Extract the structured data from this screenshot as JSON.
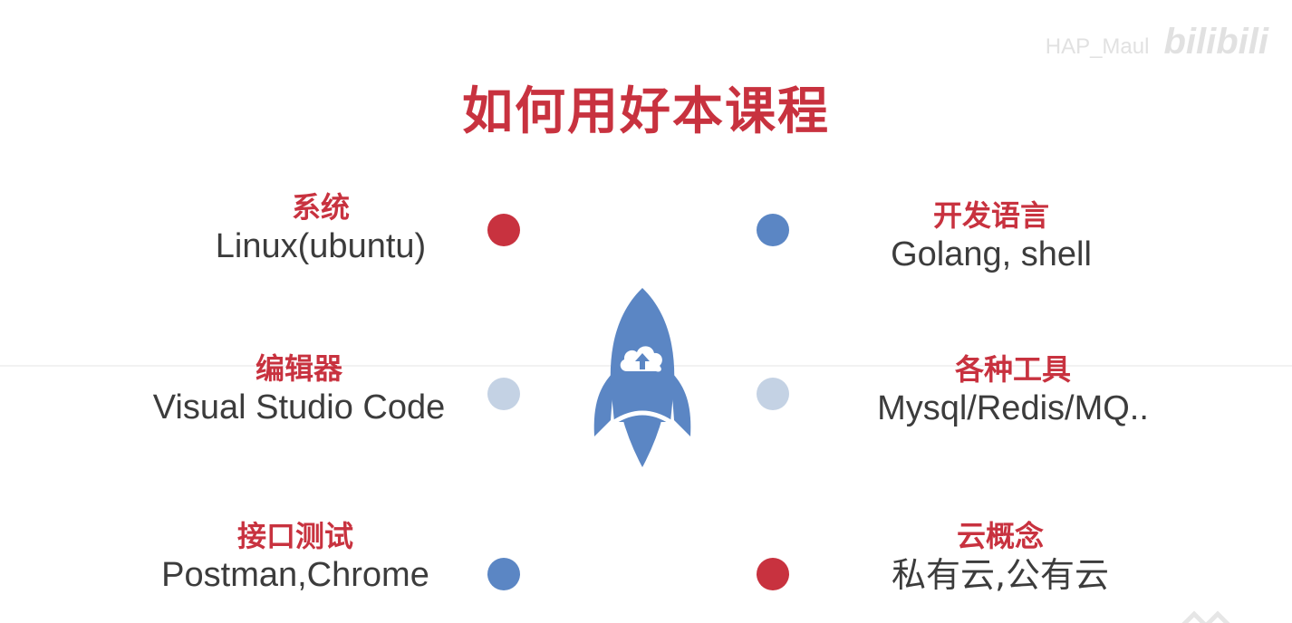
{
  "title": "如何用好本课程",
  "watermark": {
    "user": "HAP_Maul",
    "logo": "bilibili"
  },
  "colors": {
    "title_red": "#c8323f",
    "dot_red": "#c8323f",
    "dot_blue": "#5b86c4",
    "dot_light": "#c4d2e4",
    "rocket_blue": "#5b86c4",
    "text_dark": "#3c3c3c"
  },
  "center_icon": "rocket-cloud-upload-icon",
  "left_items": [
    {
      "heading": "系统",
      "detail": "Linux(ubuntu)"
    },
    {
      "heading": "编辑器",
      "detail": "Visual Studio Code"
    },
    {
      "heading": "接口测试",
      "detail": "Postman,Chrome"
    }
  ],
  "right_items": [
    {
      "heading": "开发语言",
      "detail": "Golang, shell"
    },
    {
      "heading": "各种工具",
      "detail": "Mysql/Redis/MQ.."
    },
    {
      "heading": "云概念",
      "detail": "私有云,公有云"
    }
  ]
}
